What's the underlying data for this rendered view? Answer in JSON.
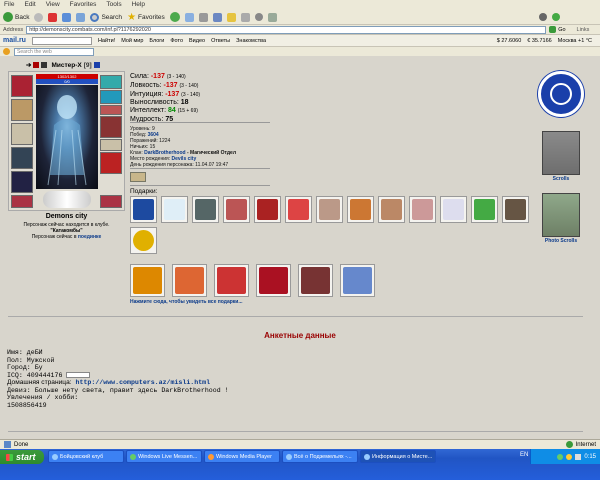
{
  "menu": [
    "File",
    "Edit",
    "View",
    "Favorites",
    "Tools",
    "Help"
  ],
  "toolbar": {
    "back": "Back",
    "search": "Search",
    "favorites": "Favorites",
    "links": "Links",
    "go": "Go"
  },
  "address": {
    "label": "Address",
    "url": "http://demonscity.combats.com/inf.pl?1176292020"
  },
  "mailru": {
    "logo": "mail.ru",
    "find": "Найти!",
    "items": [
      "Мой мир",
      "Блоги",
      "Фото",
      "Видео",
      "Ответы",
      "Знакомства"
    ],
    "currency1": "$ 27.6060",
    "currency2": "€ 35.7166",
    "weather": "Москва +1 °C"
  },
  "search": {
    "placeholder": "Search the web"
  },
  "character": {
    "name": "Мистер-Х",
    "level": "[9]",
    "hp": "1302/1302",
    "mana": "0/0",
    "city": "Demons city",
    "club_line": "Персонаж сейчас находится в клубе.",
    "club_name": "\"Катакомбы\"",
    "location_prefix": "Персонаж сейчас в",
    "location": "поединке"
  },
  "stats": [
    {
      "label": "Сила:",
      "value": "-137",
      "extra": "(3 - 140)",
      "color": "red"
    },
    {
      "label": "Ловкость:",
      "value": "-137",
      "extra": "(3 - 140)",
      "color": "red"
    },
    {
      "label": "Интуиция:",
      "value": "-137",
      "extra": "(3 - 140)",
      "color": "red"
    },
    {
      "label": "Выносливость:",
      "value": "18",
      "extra": "",
      "color": "black"
    },
    {
      "label": "Интеллект:",
      "value": "84",
      "extra": "(15 + 69)",
      "color": "green"
    },
    {
      "label": "Мудрость:",
      "value": "75",
      "extra": "",
      "color": "black"
    }
  ],
  "info": {
    "level": "Уровень: 9",
    "wins_label": "Побед:",
    "wins": "3604",
    "losses": "Поражений: 1224",
    "draws": "Ничьих: 15",
    "clan_label": "Клан:",
    "clan": "DarkBrotherhood",
    "clan_dept": "- Магический Отдел",
    "birthplace_label": "Место рождения:",
    "birthplace": "Devils city",
    "birthday": "День рождения персонажа: 11.04.07 19:47"
  },
  "gifts_title": "Подарки:",
  "gifts_link": "Нажмите сюда, чтобы увидеть все подарки...",
  "right_panel": {
    "scrolls": "Scrolls",
    "photo_scrolls": "Photo Scrolls"
  },
  "anket": {
    "title": "Анкетные данные",
    "name": "Имя: деБИ",
    "gender": "Пол: Мужской",
    "city": "Город: Бу",
    "icq": "ICQ: 409444176",
    "homepage_label": "Домашняя страница:",
    "homepage": "http://www.computers.az/misli.html",
    "motto": "Девиз: Больше нету света, правит здесь DarkBrotherhood !",
    "hobby": "Увлечения / хобби:",
    "hobby_value": "1508856419"
  },
  "status": {
    "left": "Done",
    "zone": "Internet"
  },
  "taskbar": {
    "start": "start",
    "tasks": [
      "Бойцовский клуб",
      "Windows Live Messen...",
      "Windows Media Player",
      "Всё о Подземельях -...",
      "Информация о Мисте..."
    ],
    "lang": "EN",
    "time": "0:15"
  },
  "colors": {
    "accent": "#0b3a8a",
    "red": "#cc0000",
    "green": "#008800",
    "title_red": "#990000"
  }
}
